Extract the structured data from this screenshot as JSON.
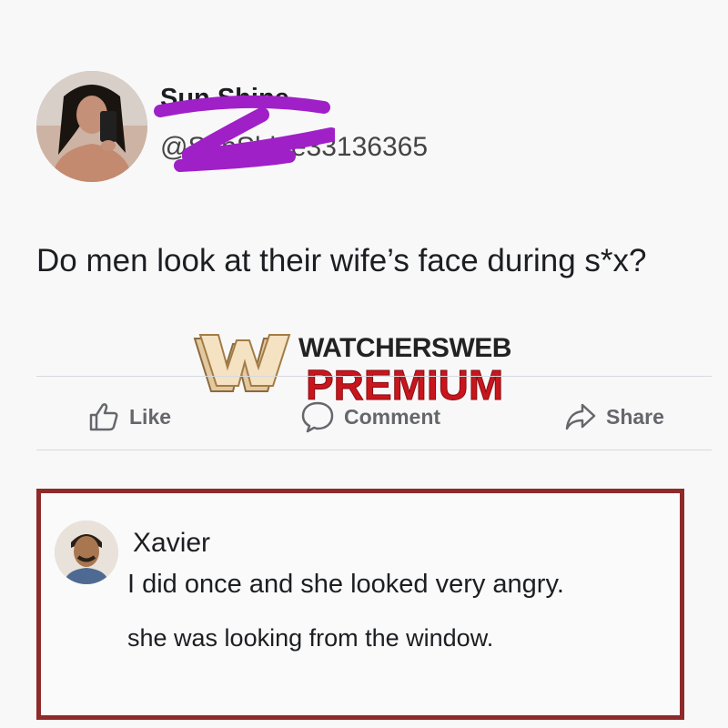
{
  "post": {
    "author_name": "Sun Shine",
    "author_handle": "@SunShine33136365",
    "text": "Do men look at their wife’s face during s*x?"
  },
  "watermark": {
    "line1": "WATCHERSWEB",
    "line2": "PREMIUM"
  },
  "actions": {
    "like_label": "Like",
    "comment_label": "Comment",
    "share_label": "Share"
  },
  "comment": {
    "author": "Xavier",
    "line1": "I did once and she looked very angry.",
    "line2": "she was looking from the window."
  },
  "colors": {
    "redaction": "#a020c8",
    "watermark_red": "#c8161d",
    "comment_border": "#8e2a2a",
    "action_gray": "#65676b"
  },
  "icons": {
    "like": "thumbs-up-icon",
    "comment": "speech-bubble-icon",
    "share": "share-arrow-icon"
  }
}
